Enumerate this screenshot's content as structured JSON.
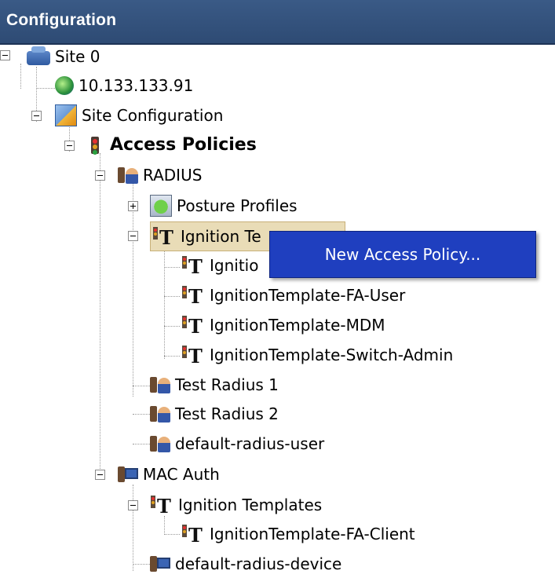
{
  "header": {
    "title": "Configuration"
  },
  "tree": {
    "site": "Site 0",
    "ip": "10.133.133.91",
    "site_config": "Site Configuration",
    "access_policies": "Access Policies",
    "radius": "RADIUS",
    "posture_profiles": "Posture Profiles",
    "ignition_templates_radius": "Ignition Te",
    "ign_item_1": "Ignitio",
    "ign_item_2": "IgnitionTemplate-FA-User",
    "ign_item_3": "IgnitionTemplate-MDM",
    "ign_item_4": "IgnitionTemplate-Switch-Admin",
    "test_radius_1": "Test Radius 1",
    "test_radius_2": "Test Radius 2",
    "default_radius_user": "default-radius-user",
    "mac_auth": "MAC Auth",
    "ignition_templates_mac": "Ignition Templates",
    "ign_mac_item_1": "IgnitionTemplate-FA-Client",
    "default_radius_device": "default-radius-device"
  },
  "context_menu": {
    "new_access_policy": "New Access Policy..."
  },
  "icons": {
    "site": "server-network-icon",
    "ip": "network-globe-icon",
    "site_config": "config-folder-icon",
    "access_policies": "traffic-light-icon",
    "radius": "radius-users-icon",
    "posture": "posture-profile-icon",
    "template": "template-icon",
    "mac": "mac-device-icon"
  }
}
